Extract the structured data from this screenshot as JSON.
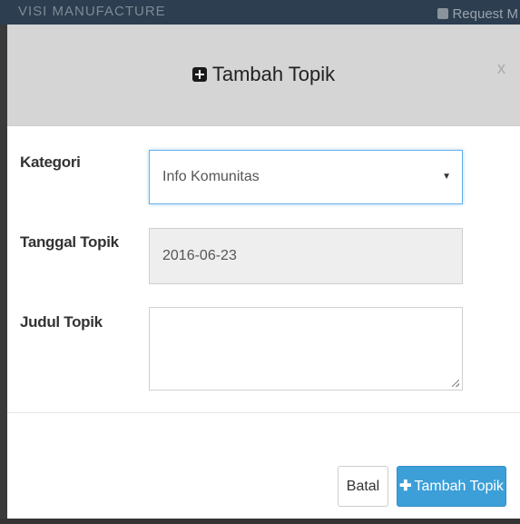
{
  "background": {
    "left_text": "VISI MANUFACTURE",
    "right_link": "Request M"
  },
  "modal": {
    "title": "Tambah Topik",
    "close_label": "x"
  },
  "form": {
    "kategori": {
      "label": "Kategori",
      "value": "Info Komunitas"
    },
    "tanggal": {
      "label": "Tanggal Topik",
      "value": "2016-06-23"
    },
    "judul": {
      "label": "Judul Topik",
      "value": ""
    }
  },
  "footer": {
    "cancel_label": "Batal",
    "submit_label": "Tambah Topik"
  },
  "colors": {
    "accent": "#3c9fd8",
    "focus_border": "#66afe9",
    "header_bg": "#d5d5d5"
  }
}
